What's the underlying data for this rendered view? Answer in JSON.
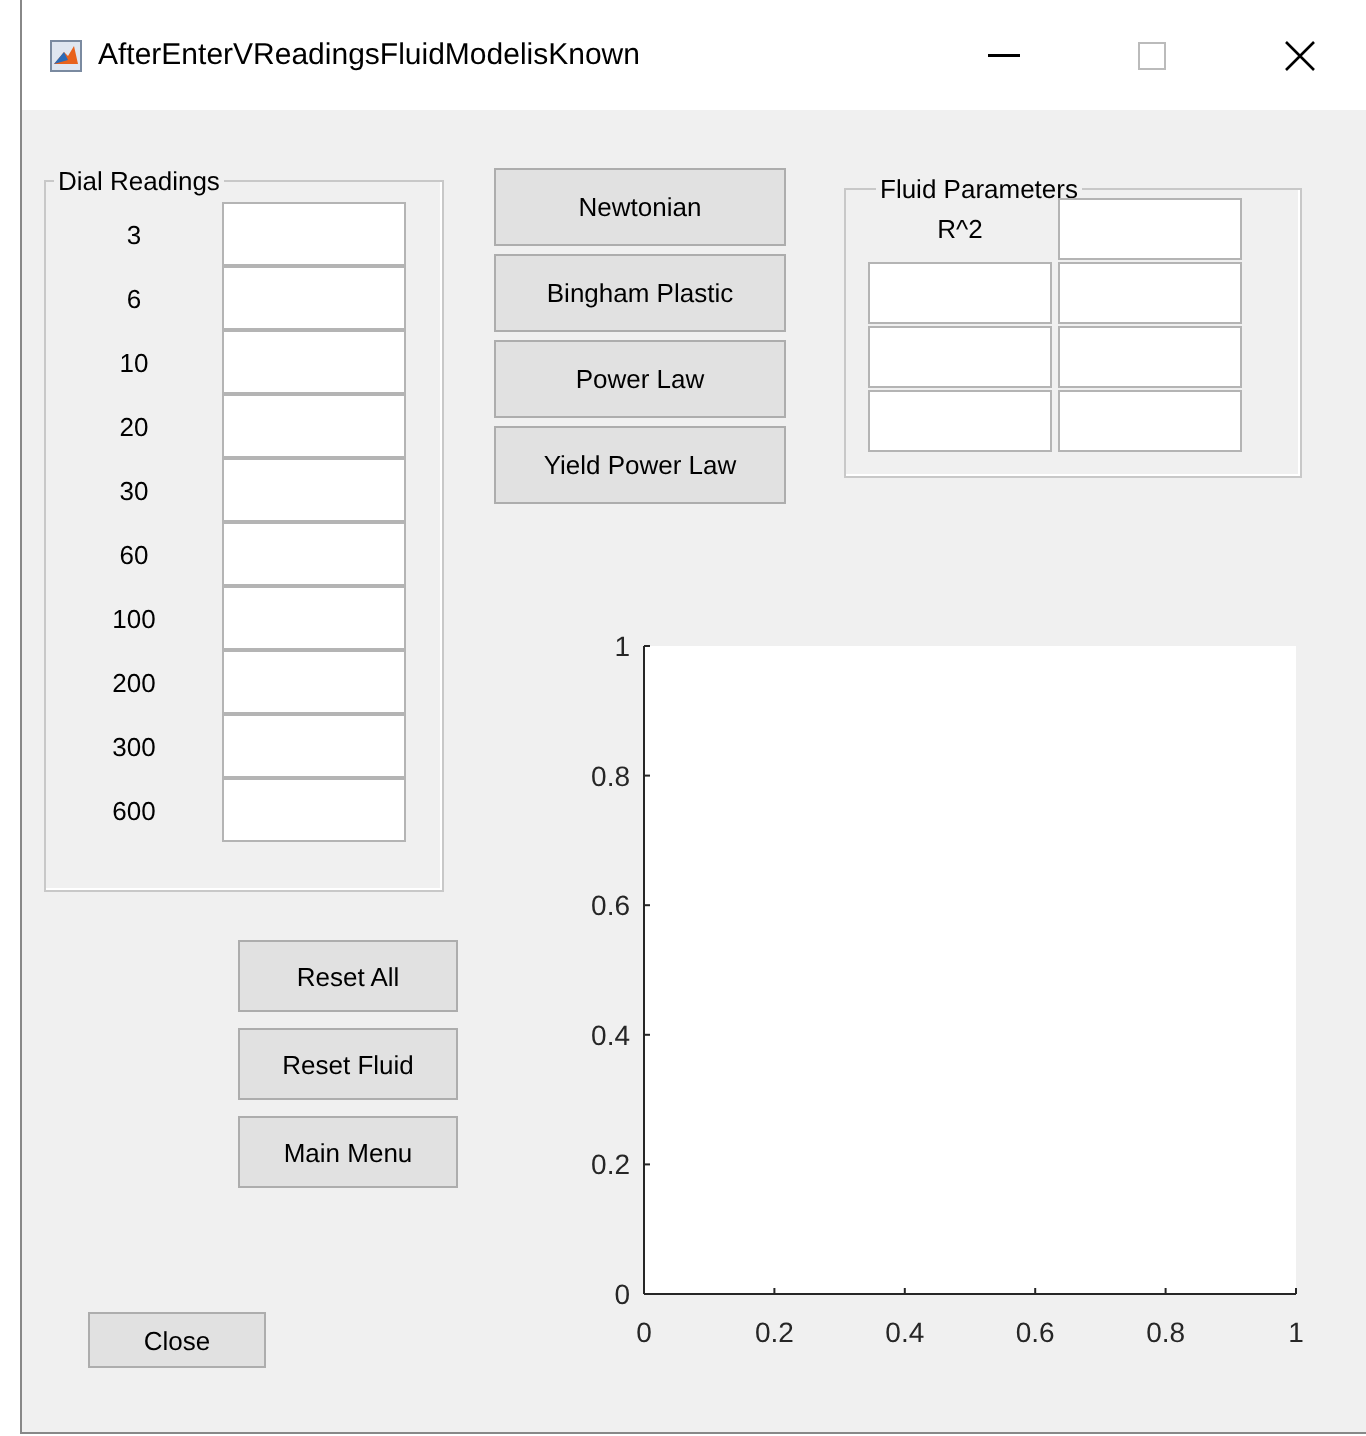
{
  "window": {
    "title": "AfterEnterVReadingsFluidModelisKnown"
  },
  "dial_readings": {
    "title": "Dial Readings",
    "rows": [
      "3",
      "6",
      "10",
      "20",
      "30",
      "60",
      "100",
      "200",
      "300",
      "600"
    ]
  },
  "model_buttons": [
    "Newtonian",
    "Bingham Plastic",
    "Power Law",
    "Yield Power Law"
  ],
  "fluid_parameters": {
    "title": "Fluid Parameters",
    "header": "R^2"
  },
  "action_buttons": [
    "Reset All",
    "Reset Fluid",
    "Main Menu"
  ],
  "close_button": "Close",
  "plot": {
    "chart_data": {
      "type": "line",
      "xlim": [
        0,
        1
      ],
      "ylim": [
        0,
        1
      ],
      "xticks": [
        0,
        0.2,
        0.4,
        0.6,
        0.8,
        1
      ],
      "yticks": [
        0,
        0.2,
        0.4,
        0.6,
        0.8,
        1
      ]
    }
  }
}
